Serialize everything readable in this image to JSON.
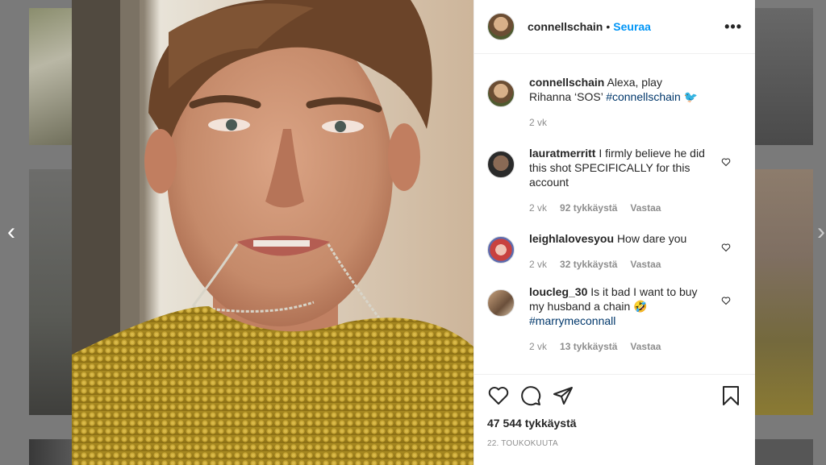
{
  "post": {
    "owner": "connellschain",
    "separator": "•",
    "follow_label": "Seuraa",
    "more_label": "•••"
  },
  "caption": {
    "user": "connellschain",
    "text_before": "Alexa, play Rihanna ‘SOS’ ",
    "hashtag": "#connellschain",
    "emoji": "🐦",
    "time": "2 vk"
  },
  "comments": [
    {
      "user": "lauratmerritt",
      "text": "I firmly believe he did this shot SPECIFICALLY for this account",
      "time": "2 vk",
      "likes": "92 tykkäystä",
      "reply": "Vastaa"
    },
    {
      "user": "leighlalovesyou",
      "text": "How dare you",
      "time": "2 vk",
      "likes": "32 tykkäystä",
      "reply": "Vastaa"
    },
    {
      "user": "loucleg_30",
      "text": "Is it bad I want to buy my husband a chain 🤣",
      "hashtag": "#marrymeconnall",
      "time": "2 vk",
      "likes": "13 tykkäystä",
      "reply": "Vastaa"
    }
  ],
  "stats": {
    "likes": "47 544 tykkäystä",
    "date": "22. TOUKOKUUTA"
  },
  "nav": {
    "prev": "‹",
    "next": "›"
  },
  "icons": {
    "like": "heart-icon",
    "comment": "comment-icon",
    "share": "share-icon",
    "save": "bookmark-icon",
    "comment_like": "heart-icon"
  },
  "colors": {
    "follow": "#0095f6",
    "hashtag": "#00376b",
    "muted": "#8e8e8e",
    "text": "#262626"
  }
}
